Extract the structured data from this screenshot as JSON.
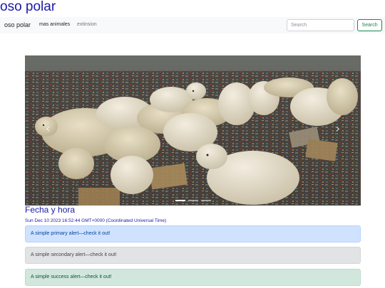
{
  "site": {
    "title": "oso polar"
  },
  "navbar": {
    "brand": "oso polar",
    "links": [
      "mas animales",
      "extinsion"
    ],
    "search_placeholder": "Search",
    "search_button": "Search"
  },
  "carousel": {
    "slide_count": 3,
    "active_slide": 1,
    "image_subject": "polar bears at a garbage dump"
  },
  "datetime": {
    "heading": "Fecha y hora",
    "value": "Sun Dec 10 2023 16:52:44 GMT+0000 (Coordinated Universal Time)"
  },
  "alerts": [
    {
      "type": "primary",
      "text": "A simple primary alert—check it out!"
    },
    {
      "type": "secondary",
      "text": "A simple secondary alert—check it out!"
    },
    {
      "type": "success",
      "text": "A simple success alert—check it out!"
    }
  ],
  "colors": {
    "title_blue": "#1a1aa6",
    "success_green": "#198754",
    "navbar_bg": "#f8f9fa"
  }
}
